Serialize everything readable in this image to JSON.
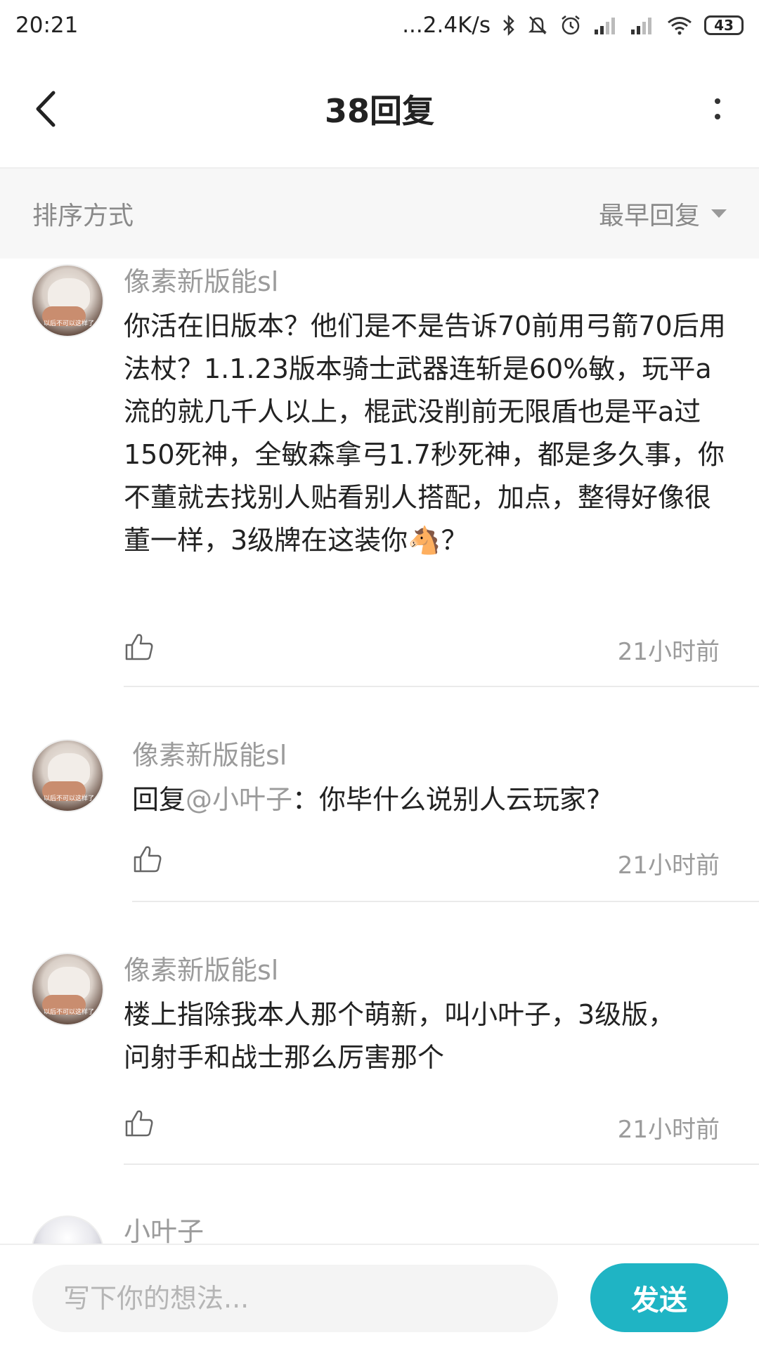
{
  "status_bar": {
    "time": "20:21",
    "network_speed": "...2.4K/s",
    "battery": "43",
    "icons": [
      "bluetooth-icon",
      "mute-icon",
      "alarm-icon",
      "signal-icon",
      "signal-icon",
      "wifi-icon",
      "battery-icon"
    ]
  },
  "header": {
    "title": "38回复",
    "back_icon": "chevron-left-icon",
    "more_icon": "more-vertical-icon"
  },
  "sort": {
    "label": "排序方式",
    "selected": "最早回复",
    "caret_icon": "caret-down-icon"
  },
  "comments": [
    {
      "author": "像素新版能sl",
      "avatar_caption": "以后不可以这样了",
      "text": "你活在旧版本？他们是不是告诉70前用弓箭70后用法杖？1.1.23版本骑士武器连斩是60%敏，玩平a流的就几千人以上，棍武没削前无限盾也是平a过150死神，全敏森拿弓1.7秒死神，都是多久事，你不董就去找别人贴看别人搭配，加点，整得好像很董一样，3级牌在这装你🐴？",
      "time": "21小时前"
    },
    {
      "author": "像素新版能sl",
      "avatar_caption": "以后不可以这样了",
      "reply_prefix": "回复",
      "reply_to": "@小叶子",
      "text": "：你毕什么说别人云玩家?",
      "time": "21小时前"
    },
    {
      "author": "像素新版能sl",
      "avatar_caption": "以后不可以这样了",
      "text": "楼上指除我本人那个萌新，叫小叶子，3级版，问射手和战士那么厉害那个",
      "time": "21小时前"
    },
    {
      "author": "小叶子"
    }
  ],
  "composer": {
    "placeholder": "写下你的想法...",
    "send_label": "发送"
  },
  "colors": {
    "accent": "#1fb4c4",
    "muted_text": "#9b9b9b",
    "sort_bar_bg": "#f7f7f7"
  }
}
